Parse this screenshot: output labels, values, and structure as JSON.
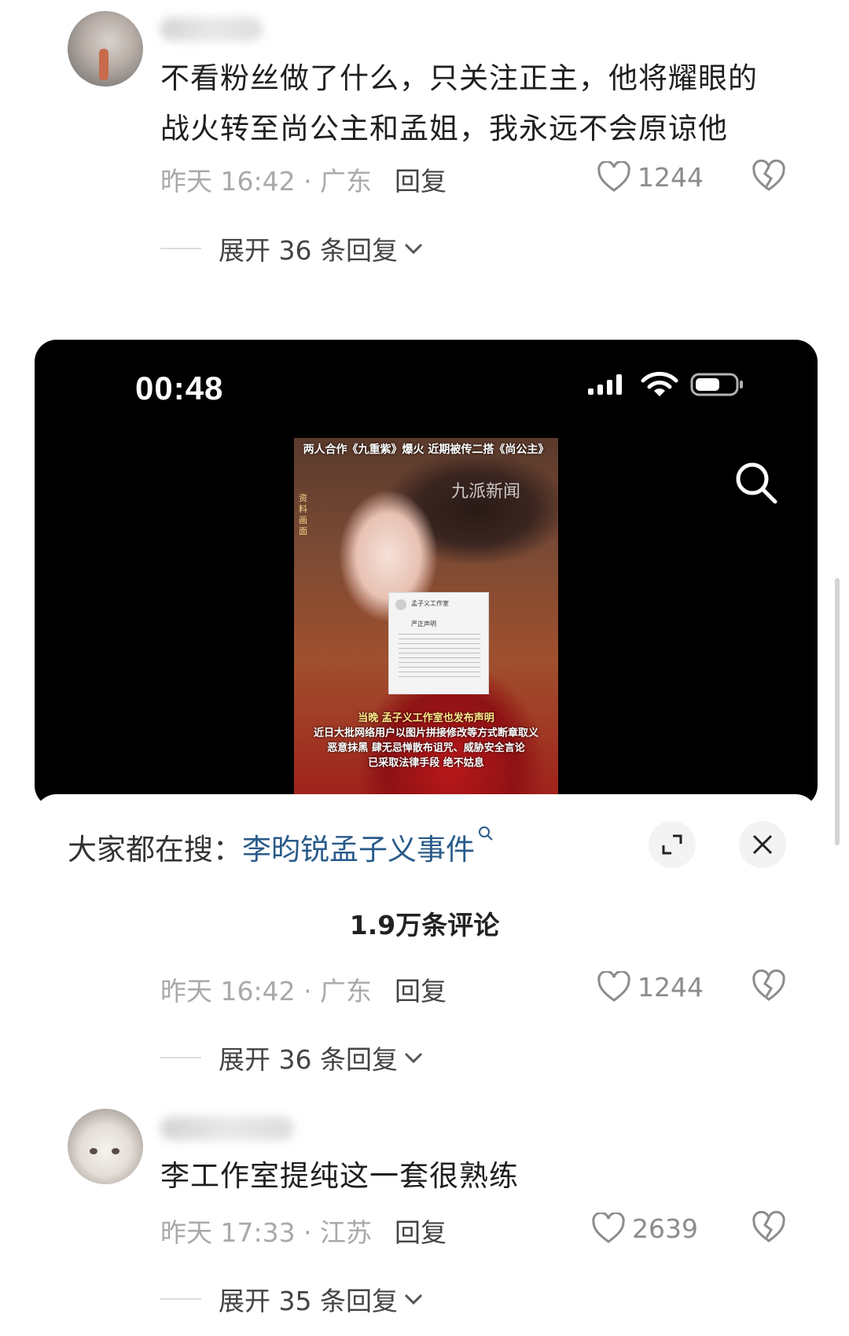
{
  "comments": [
    {
      "text_line1": "不看粉丝做了什么，只关注正主，他将耀眼的",
      "text_line2": "战火转至尚公主和孟姐，我永远不会原谅他",
      "time": "昨天 16:42 · 广东",
      "reply_label": "回复",
      "likes": "1244",
      "expand_label": "展开 36 条回复"
    },
    {
      "time": "昨天 16:42 · 广东",
      "reply_label": "回复",
      "likes": "1244",
      "expand_label": "展开 36 条回复"
    },
    {
      "text_line1": "李工作室提纯这一套很熟练",
      "time": "昨天 17:33 · 江苏",
      "reply_label": "回复",
      "likes": "2639",
      "expand_label": "展开 35 条回复"
    }
  ],
  "video": {
    "status_time": "00:48",
    "caption_top": "两人合作《九重紫》爆火 近期被传二搭《尚公主》",
    "side_text": "资料画面",
    "watermark": "九派新闻",
    "doc_title": "孟子义工作室",
    "doc_subtitle": "严正声明",
    "subtitle_1": "当晚 孟子义工作室也发布声明",
    "subtitle_2": "近日大批网络用户以图片拼接修改等方式断章取义",
    "subtitle_3": "恶意抹黑 肆无忌惮散布诅咒、威胁安全言论",
    "subtitle_4": "已采取法律手段 绝不姑息"
  },
  "search_bar": {
    "prefix": "大家都在搜：",
    "term": "李昀锐孟子义事件"
  },
  "comment_count": "1.9万条评论",
  "icons": [
    "heart-icon",
    "broken-heart-icon",
    "chevron-down-icon",
    "search-icon",
    "expand-icon",
    "close-icon",
    "signal-icon",
    "wifi-icon",
    "battery-icon"
  ]
}
